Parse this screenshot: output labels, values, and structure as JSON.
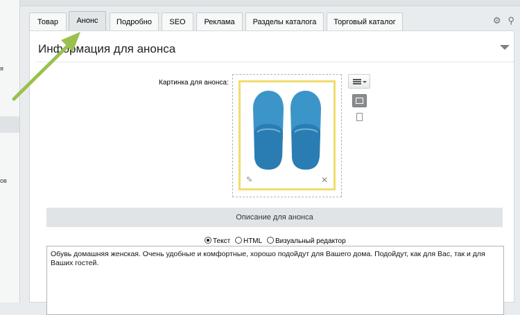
{
  "tabs": [
    {
      "label": "Товар"
    },
    {
      "label": "Анонс",
      "active": true
    },
    {
      "label": "Подробно"
    },
    {
      "label": "SEO"
    },
    {
      "label": "Реклама"
    },
    {
      "label": "Разделы каталога"
    },
    {
      "label": "Торговый каталог"
    }
  ],
  "leftnav": {
    "frag1": "я",
    "frag2": "ов"
  },
  "panel": {
    "title": "Информация для анонса"
  },
  "picture": {
    "label": "Картинка для анонса:",
    "image": "blue slippers product photo"
  },
  "description": {
    "header": "Описание для анонса",
    "modes": [
      "Текст",
      "HTML",
      "Визуальный редактор"
    ],
    "selected_mode": "Текст",
    "text": "Обувь домашняя женская. Очень удобные и комфортные, хорошо подойдут для Вашего дома. Подойдут, как для Вас, так и для Ваших гостей."
  },
  "colors": {
    "accent_arrow": "#9ac14d",
    "frame_highlight": "#f0dd6a"
  }
}
